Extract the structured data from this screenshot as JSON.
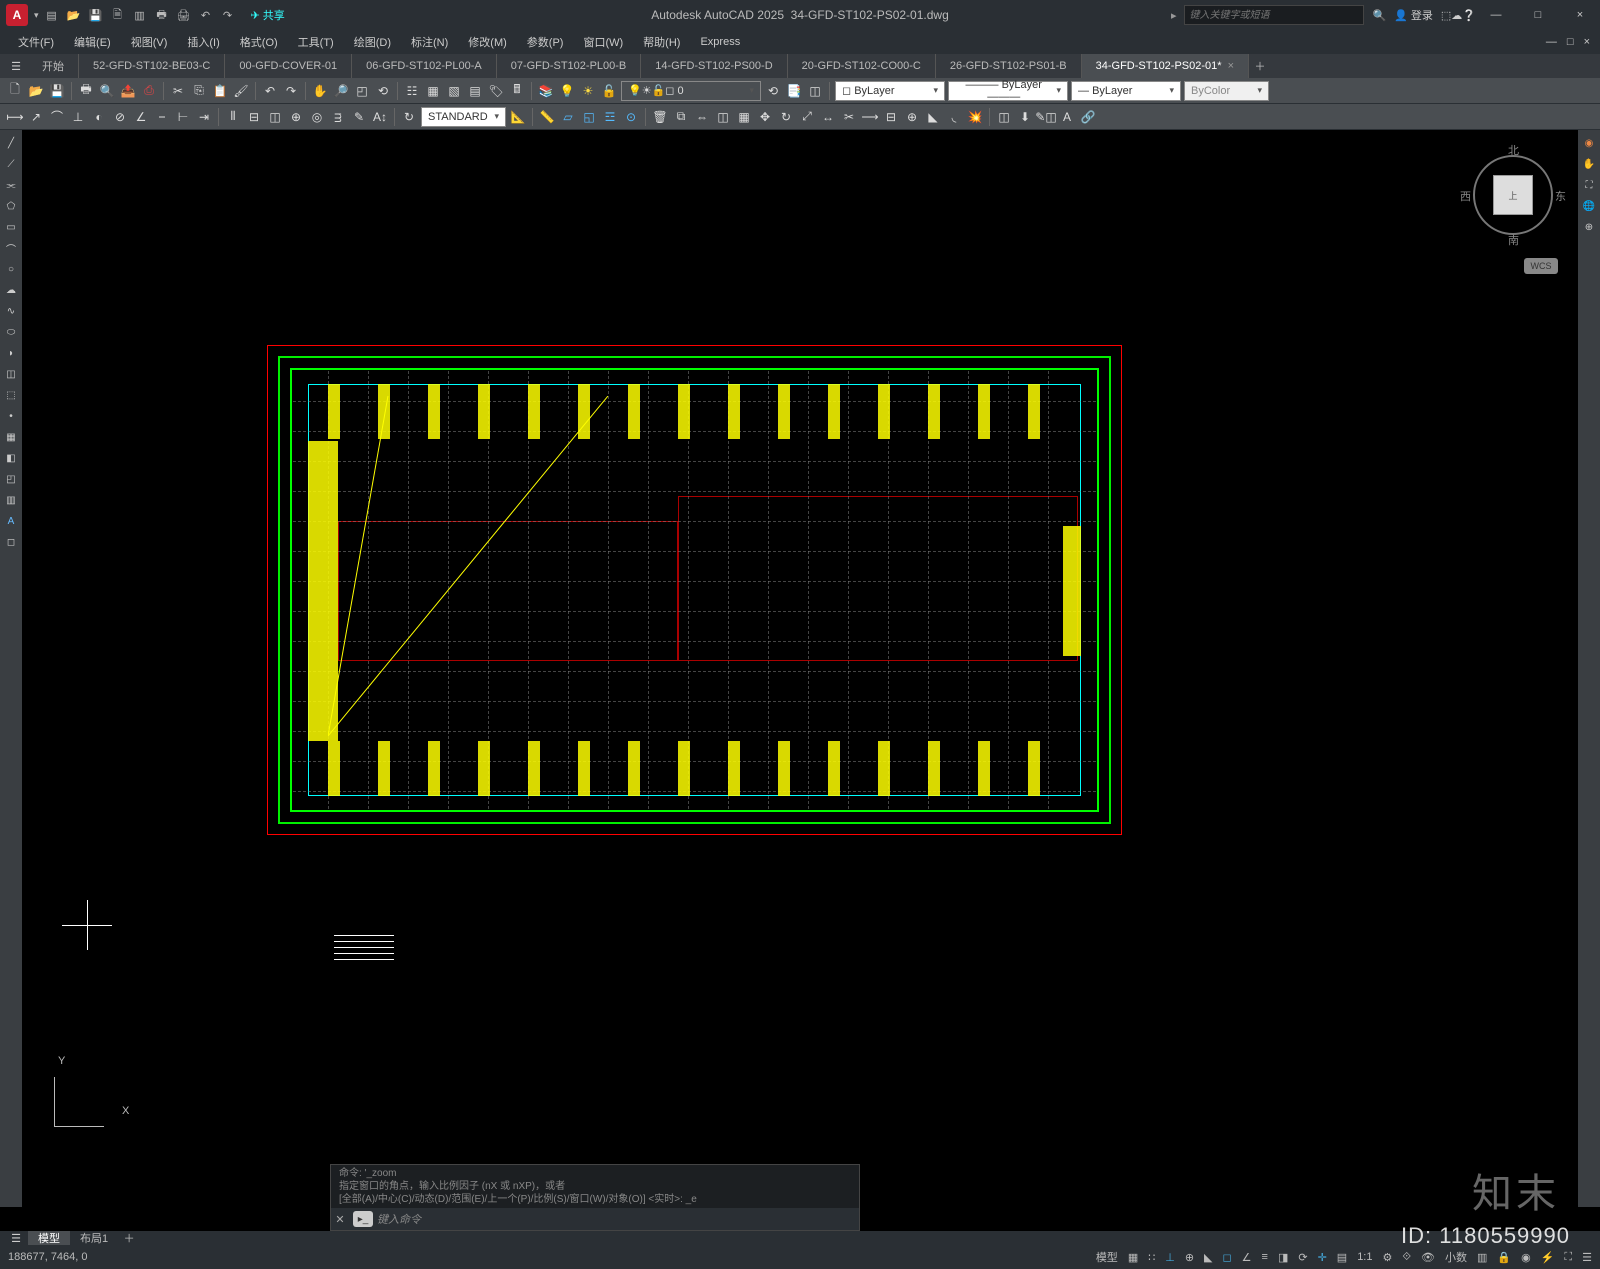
{
  "app": {
    "logo_letter": "A",
    "name": "Autodesk AutoCAD 2025",
    "filename": "34-GFD-ST102-PS02-01.dwg"
  },
  "qat": [
    "new",
    "open",
    "save",
    "saveas",
    "plot",
    "undo",
    "redo"
  ],
  "share": "共享",
  "search": {
    "placeholder": "键入关键字或短语"
  },
  "login": "登录",
  "window": {
    "min": "—",
    "max": "□",
    "close": "×",
    "restore": "□",
    "mini_close": "×"
  },
  "menus": [
    "文件(F)",
    "编辑(E)",
    "视图(V)",
    "插入(I)",
    "格式(O)",
    "工具(T)",
    "绘图(D)",
    "标注(N)",
    "修改(M)",
    "参数(P)",
    "窗口(W)",
    "帮助(H)",
    "Express"
  ],
  "file_tabs": {
    "start": "开始",
    "items": [
      "52-GFD-ST102-BE03-C",
      "00-GFD-COVER-01",
      "06-GFD-ST102-PL00-A",
      "07-GFD-ST102-PL00-B",
      "14-GFD-ST102-PS00-D",
      "20-GFD-ST102-CO00-C",
      "26-GFD-ST102-PS01-B",
      "34-GFD-ST102-PS02-01*"
    ],
    "active_index": 7
  },
  "ribbon": {
    "layer_value": "0",
    "bylayer1": "ByLayer",
    "bylayer2": "ByLayer",
    "bylayer3": "ByLayer",
    "bycolor": "ByColor",
    "standard": "STANDARD"
  },
  "viewcube": {
    "top": "上",
    "n": "北",
    "s": "南",
    "e": "东",
    "w": "西",
    "wcs": "WCS"
  },
  "ucs": {
    "x": "X",
    "y": "Y"
  },
  "cmd": {
    "hist1": "命令: '_zoom",
    "hist2": "指定窗口的角点，输入比例因子 (nX 或 nXP)，或者",
    "hist3": "[全部(A)/中心(C)/动态(D)/范围(E)/上一个(P)/比例(S)/窗口(W)/对象(O)] <实时>: _e",
    "placeholder": "键入命令"
  },
  "layout_tabs": {
    "model": "模型",
    "layout1": "布局1"
  },
  "statusbar": {
    "coords": "188677, 7464, 0",
    "model": "模型",
    "grid": "#",
    "ortho": "⊥",
    "polar": "※",
    "snap": "□",
    "scale": "1:1",
    "decimal": "小数"
  },
  "watermark": {
    "brand": "知末",
    "id": "ID: 1180559990"
  }
}
